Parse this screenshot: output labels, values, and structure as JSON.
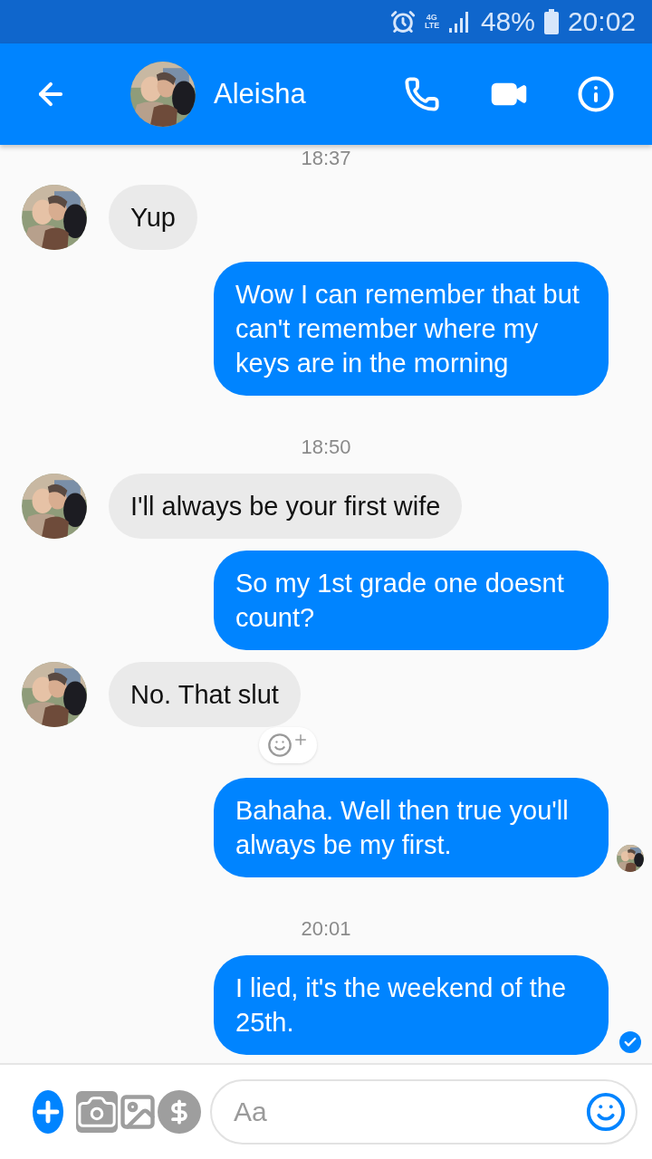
{
  "status_bar": {
    "network": "4G LTE",
    "battery": "48%",
    "time": "20:02",
    "alarm": true
  },
  "header": {
    "name": "Aleisha"
  },
  "messages": [
    {
      "kind": "time",
      "text": "18:37"
    },
    {
      "kind": "received",
      "text": "Yup",
      "avatar": true
    },
    {
      "kind": "sent",
      "text": "Wow I can remember that but can't remember where my keys are in the morning",
      "seen": false,
      "delivered": false
    },
    {
      "kind": "time",
      "text": "18:50"
    },
    {
      "kind": "received",
      "text": "I'll always be your first wife",
      "avatar": true
    },
    {
      "kind": "sent",
      "text": "So my 1st grade one doesnt count?",
      "seen": false,
      "delivered": false
    },
    {
      "kind": "received",
      "text": "No. That slut",
      "avatar": true,
      "reaction_button": true
    },
    {
      "kind": "sent",
      "text": "Bahaha. Well then true you'll always be my first.",
      "seen": true,
      "delivered": false
    },
    {
      "kind": "time",
      "text": "20:01"
    },
    {
      "kind": "sent",
      "text": "I lied, it's the weekend of the 25th.",
      "seen": false,
      "delivered": true
    }
  ],
  "composer": {
    "placeholder": "Aa"
  }
}
